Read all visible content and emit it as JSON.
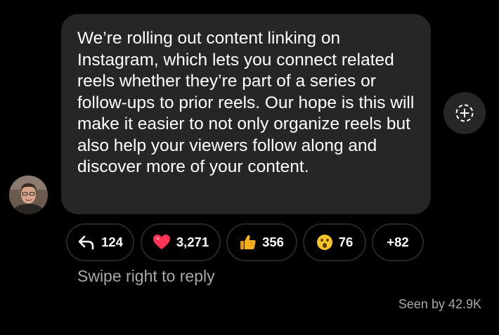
{
  "message": {
    "text": "We’re rolling out content linking on Instagram, which lets you connect related reels whether they’re part of a series or follow-ups to prior reels. Our hope is this will make it easier to not only organize reels but also help your viewers follow along and discover more of your content."
  },
  "share_button": {
    "icon": "add-circle-icon"
  },
  "reactions": [
    {
      "icon": "reply-arrow-icon",
      "count": "124"
    },
    {
      "icon": "heart-emoji-icon",
      "count": "3,271"
    },
    {
      "icon": "thumbs-up-emoji-icon",
      "count": "356"
    },
    {
      "icon": "surprised-face-emoji-icon",
      "count": "76"
    },
    {
      "count": "+82"
    }
  ],
  "hint": "Swipe right to reply",
  "seen_by": "Seen by 42.9K",
  "colors": {
    "background": "#000000",
    "bubble": "#262626",
    "text": "#ffffff",
    "muted_text": "#a8a8a8",
    "heart": "#ff3355",
    "thumb": "#f5b21d"
  }
}
